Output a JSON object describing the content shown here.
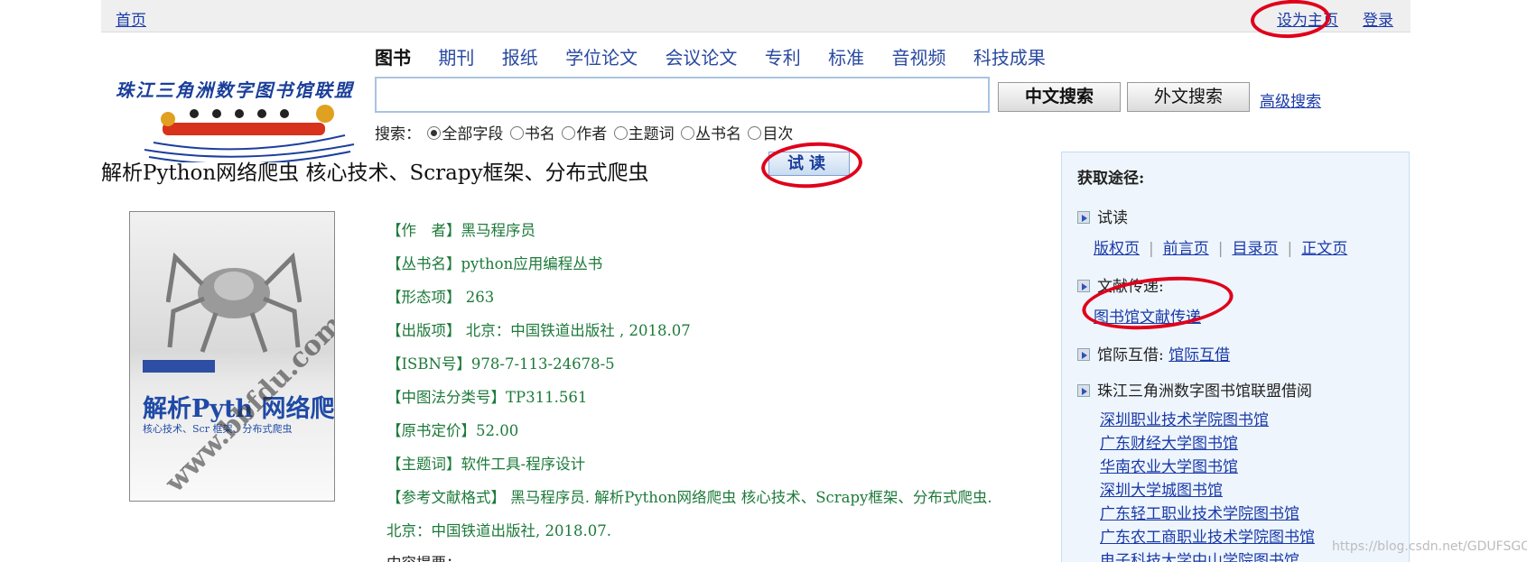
{
  "topbar": {
    "home": "首页",
    "set_home": "设为主页",
    "login": "登录"
  },
  "logo": {
    "text": "珠江三角洲数字图书馆联盟"
  },
  "tabs": [
    "图书",
    "期刊",
    "报纸",
    "学位论文",
    "会议论文",
    "专利",
    "标准",
    "音视频",
    "科技成果"
  ],
  "search": {
    "value": "",
    "cn_button": "中文搜索",
    "foreign_button": "外文搜索",
    "advanced": "高级搜索",
    "options_label": "搜索：",
    "options": [
      "全部字段",
      "书名",
      "作者",
      "主题词",
      "丛书名",
      "目次"
    ]
  },
  "book": {
    "title": "解析Python网络爬虫 核心技术、Scrapy框架、分布式爬虫",
    "trial_button": "试读",
    "meta": [
      "【作　者】黑马程序员",
      "【丛书名】python应用编程丛书",
      "【形态项】 263",
      "【出版项】 北京：中国铁道出版社 , 2018.07",
      "【ISBN号】978-7-113-24678-5",
      "【中图法分类号】TP311.561",
      "【原书定价】52.00",
      "【主题词】软件工具-程序设计",
      "【参考文献格式】 黑马程序员. 解析Python网络爬虫 核心技术、Scrapy框架、分布式爬虫.",
      "北京：中国铁道出版社, 2018.07.",
      "内容提要："
    ]
  },
  "cover": {
    "title": "解析Pyth 网络爬虫：",
    "subtitle": "核心技术、Scr 框架、分布式爬虫",
    "watermark": "www.bbfdu.com"
  },
  "sidebar": {
    "heading": "获取途径:",
    "trial": "试读",
    "trial_links": [
      "版权页",
      "前言页",
      "目录页",
      "正文页"
    ],
    "doc_delivery": "文献传递:",
    "doc_delivery_link": "图书馆文献传递",
    "ill": "馆际互借:",
    "ill_link": "馆际互借",
    "union": "珠江三角洲数字图书馆联盟借阅",
    "libraries": [
      "深圳职业技术学院图书馆",
      "广东财经大学图书馆",
      "华南农业大学图书馆",
      "深圳大学城图书馆",
      "广东轻工职业技术学院图书馆",
      "广东农工商职业技术学院图书馆",
      "电子科技大学中山学院图书馆"
    ]
  },
  "footer_mark": "https://blog.csdn.net/GDUFSGOP",
  "colors": {
    "link": "#1a3aa8",
    "meta_green": "#1d7a3a",
    "annotation_red": "#e0001b",
    "sidebar_bg": "#eef5fc"
  }
}
